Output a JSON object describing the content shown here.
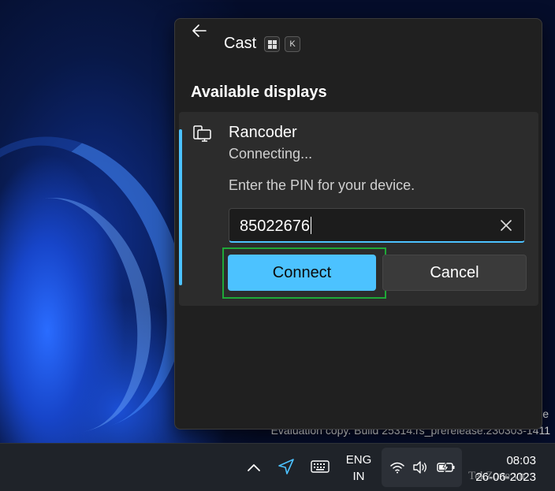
{
  "desktop": {
    "watermark_line1": "ge",
    "watermark_line2": "Evaluation copy. Build 25314.rs_prerelease.230303-1411"
  },
  "cast_panel": {
    "title": "Cast",
    "shortcut_key": "K",
    "section_title": "Available displays",
    "device": {
      "name": "Rancoder",
      "status": "Connecting...",
      "pin_prompt": "Enter the PIN for your device.",
      "pin_value": "85022676",
      "connect_label": "Connect",
      "cancel_label": "Cancel"
    },
    "accent_color": "#4cc2ff",
    "highlight_color": "#1fa838"
  },
  "taskbar": {
    "language_line1": "ENG",
    "language_line2": "IN",
    "time": "08:03",
    "date": "26-06-2023",
    "brand_watermark": "TekZone.vn"
  }
}
